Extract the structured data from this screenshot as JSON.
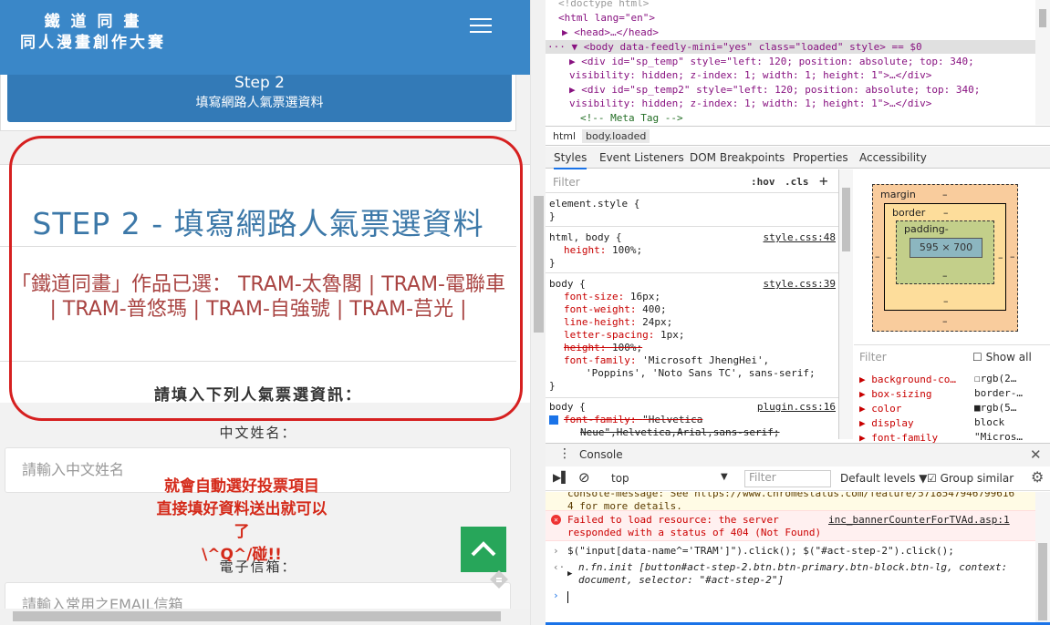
{
  "page": {
    "brand_line1": "鐵 道 同 畫",
    "brand_line2": "同人漫畫創作大賽",
    "step_title": "Step 2",
    "step_subtitle": "填寫網路人氣票選資料",
    "step_heading": "STEP 2 - 填寫網路人氣票選資料",
    "selected_text": "「鐵道同畫」作品已選： TRAM-太魯閣 | TRAM-電聯車 | TRAM-普悠瑪 | TRAM-自強號 | TRAM-莒光 |",
    "fill_prompt": "請填入下列人氣票選資訊：",
    "name_label": "中文姓名：",
    "name_placeholder": "請輸入中文姓名",
    "email_label": "電子信箱：",
    "email_placeholder": "請輸入常用之EMAIL信箱",
    "annotation_line1": "就會自動選好投票項目",
    "annotation_line2": "直接填好資料送出就可以了",
    "annotation_line3": "\\^Q^/碰!!"
  },
  "devtools": {
    "elements": {
      "doctype": "<!doctype html>",
      "html_open": "<html lang=\"en\">",
      "head": "<head>…</head>",
      "body_line": "<body data-feedly-mini=\"yes\" class=\"loaded\" style> == $0",
      "div1_a": "<div id=\"sp_temp\" style=\"left: 120; position: absolute; top: 340;",
      "div1_b": "visibility: hidden; z-index: 1; width: 1; height: 1\">…</div>",
      "div2_a": "<div id=\"sp_temp2\" style=\"left: 120; position: absolute; top: 340;",
      "div2_b": "visibility: hidden; z-index: 1; width: 1; height: 1\">…</div>",
      "comment": "<!-- Meta Tag -->"
    },
    "breadcrumbs": [
      "html",
      "body.loaded"
    ],
    "tabs": [
      "Styles",
      "Event Listeners",
      "DOM Breakpoints",
      "Properties",
      "Accessibility"
    ],
    "styles": {
      "filter_placeholder": "Filter",
      "hov": ":hov",
      "cls": ".cls",
      "plus": "+",
      "element_style": "element.style {",
      "close": "}",
      "rule2_sel": "html, body {",
      "rule2_src": "style.css:48",
      "rule2_p1": "height",
      "rule2_v1": "100%;",
      "rule3_sel": "body {",
      "rule3_src": "style.css:39",
      "rule3_props": [
        {
          "p": "font-size",
          "v": "16px;"
        },
        {
          "p": "font-weight",
          "v": "400;"
        },
        {
          "p": "line-height",
          "v": "24px;"
        },
        {
          "p": "letter-spacing",
          "v": "1px;"
        },
        {
          "p": "height",
          "v": "100%;"
        },
        {
          "p": "font-family",
          "v": "'Microsoft JhengHei',"
        }
      ],
      "rule3_font_cont": "'Poppins', 'Noto Sans TC', sans-serif;",
      "rule4_sel": "body {",
      "rule4_src": "plugin.css:16",
      "rule4_p": "font-family",
      "rule4_v": "\"Helvetica",
      "rule4_cont": "Neue\",Helvetica,Arial,sans-serif;"
    },
    "boxmodel": {
      "margin": "margin",
      "border": "border",
      "padding": "padding-",
      "content": "595 × 700",
      "dash": "–"
    },
    "computed": {
      "filter": "Filter",
      "show_all": "Show all",
      "rows": [
        {
          "p": "background-co…",
          "v": "rgb(2…"
        },
        {
          "p": "box-sizing",
          "v": "border-…"
        },
        {
          "p": "color",
          "v": "rgb(5…"
        },
        {
          "p": "display",
          "v": "block"
        },
        {
          "p": "font-family",
          "v": "\"Micros…"
        }
      ]
    },
    "console": {
      "tab": "Console",
      "context": "top",
      "filter_placeholder": "Filter",
      "levels": "Default levels ▼",
      "group_similar": "Group similar",
      "warn_line1": "console-message: See https://www.chromestatus.com/feature/5718547946799616",
      "warn_line2": "4 for more details.",
      "err_line1": "Failed to load resource: the server",
      "err_line2": "responded with a status of 404 (Not Found)",
      "err_link": "inc_bannerCounterForTVAd.asp:1",
      "command": "$(\"input[data-name^='TRAM']\").click(); $(\"#act-step-2\").click();",
      "result_line1": "n.fn.init [button#act-step-2.btn.btn-primary.btn-block.btn-lg, context:",
      "result_line2": "document, selector: \"#act-step-2\"]"
    }
  },
  "colors": {
    "navbar": "#3a87c8",
    "step_button": "#337ab7",
    "heading": "#3c78a8",
    "selected_text": "#a94442",
    "annotation": "#d42a1a",
    "back_to_top": "#27a65a"
  }
}
